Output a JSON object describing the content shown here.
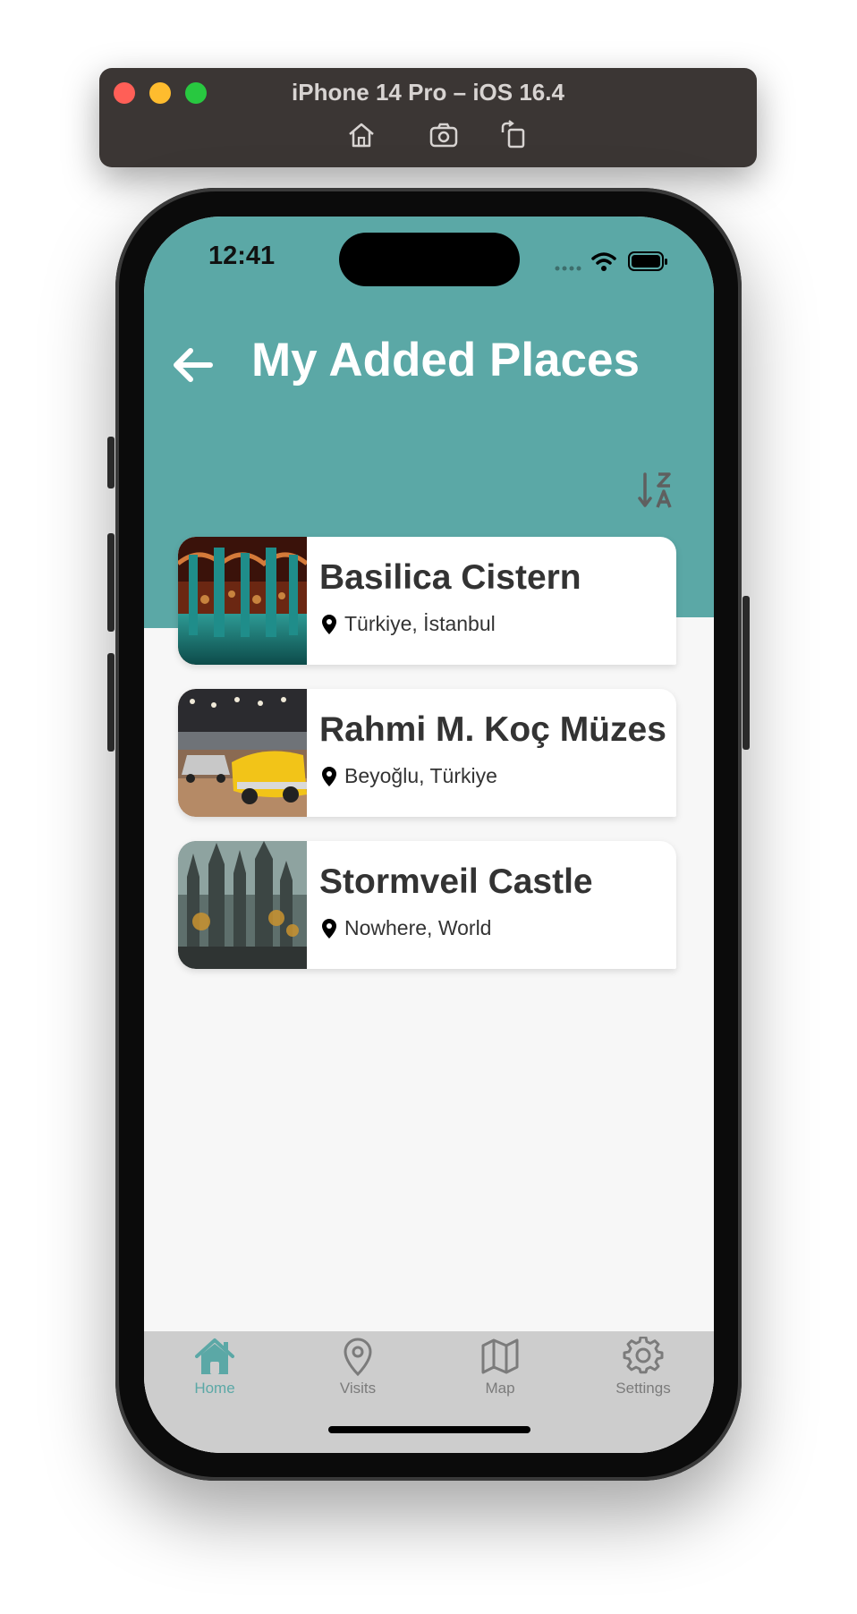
{
  "simulator": {
    "title": "iPhone 14 Pro – iOS 16.4",
    "tools": [
      "home-icon",
      "screenshot-icon",
      "rotate-icon"
    ]
  },
  "status_bar": {
    "time": "12:41"
  },
  "header": {
    "title": "My Added Places",
    "back_icon": "arrow-left-icon"
  },
  "sort_icon": "sort-z-a-icon",
  "places": [
    {
      "name": "Basilica Cistern",
      "location": "Türkiye, İstanbul"
    },
    {
      "name": "Rahmi M. Koç Müzes",
      "location": "Beyoğlu, Türkiye"
    },
    {
      "name": "Stormveil Castle",
      "location": "Nowhere, World"
    }
  ],
  "tabbar": {
    "items": [
      {
        "label": "Home",
        "icon": "home-icon",
        "active": true
      },
      {
        "label": "Visits",
        "icon": "map-pin-icon",
        "active": false
      },
      {
        "label": "Map",
        "icon": "map-icon",
        "active": false
      },
      {
        "label": "Settings",
        "icon": "gear-icon",
        "active": false
      }
    ]
  },
  "colors": {
    "accent": "#5ba8a6",
    "tab_inactive": "#7b7b7b",
    "tabbar_bg": "#cdcdcd"
  }
}
